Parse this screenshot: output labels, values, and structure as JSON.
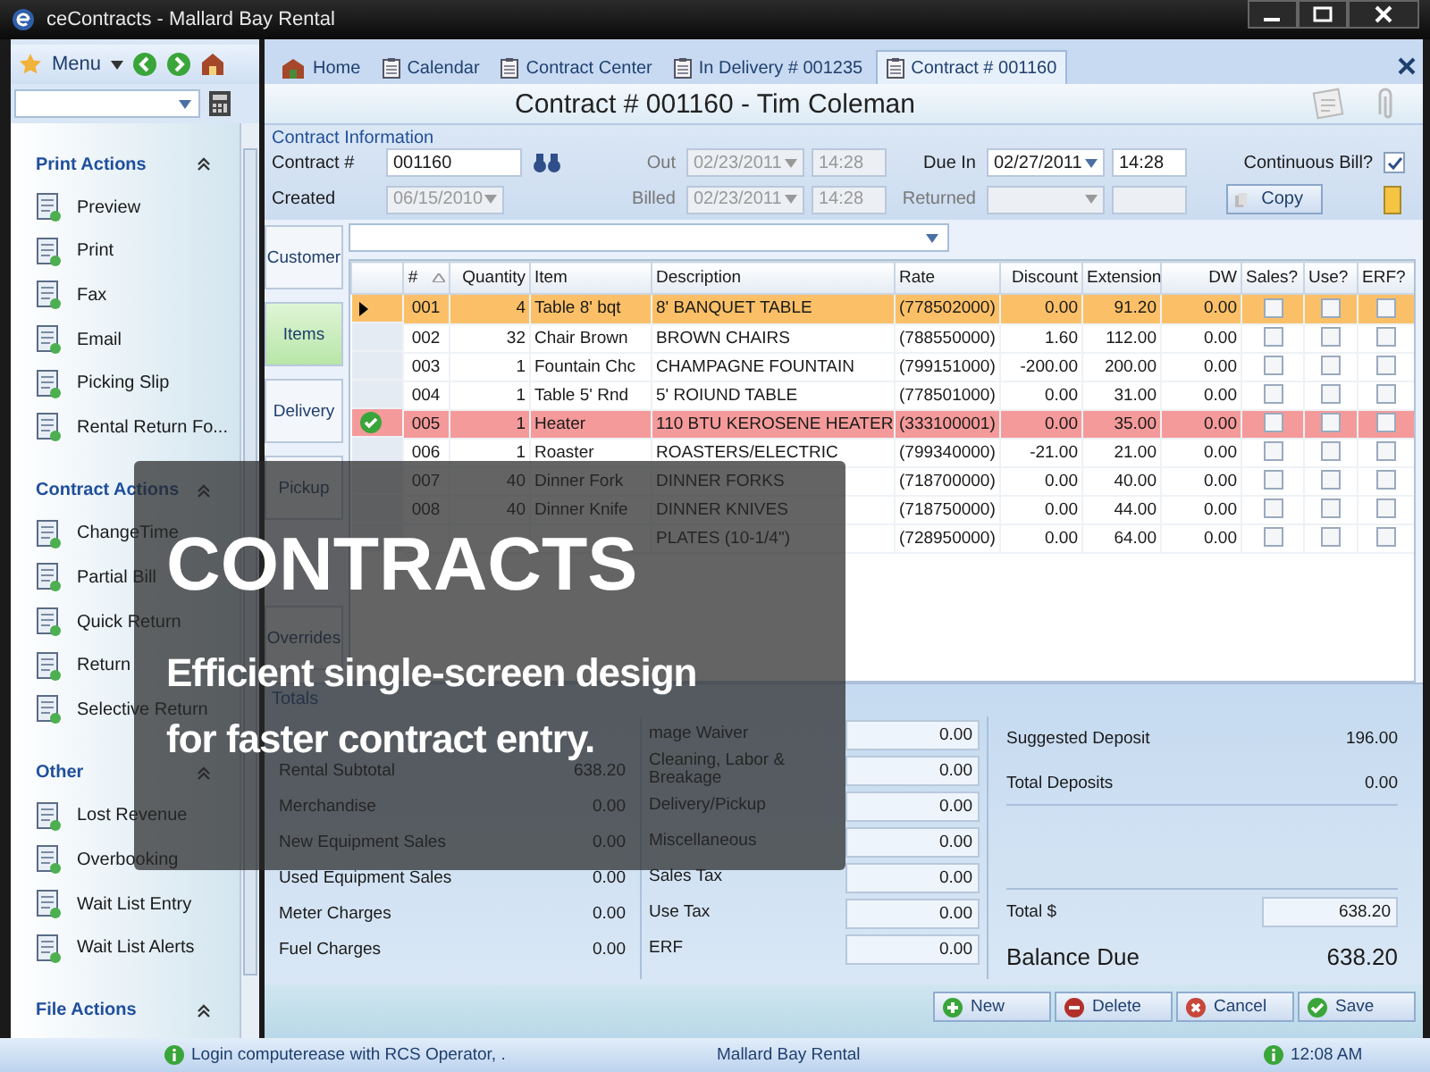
{
  "window": {
    "title": "ceContracts - Mallard Bay Rental"
  },
  "sidebar": {
    "menu_label": "Menu",
    "groups": [
      {
        "title": "Print Actions",
        "items": [
          "Preview",
          "Print",
          "Fax",
          "Email",
          "Picking Slip",
          "Rental Return Fo..."
        ]
      },
      {
        "title": "Contract Actions",
        "items": [
          "ChangeTime",
          "Partial Bill",
          "Quick Return",
          "Return",
          "Selective Return"
        ]
      },
      {
        "title": "Other",
        "items": [
          "Lost Revenue",
          "Overbooking",
          "Wait List Entry",
          "Wait List Alerts"
        ]
      },
      {
        "title": "File Actions"
      }
    ]
  },
  "tabs": [
    {
      "label": "Home",
      "selected": false
    },
    {
      "label": "Calendar",
      "selected": false
    },
    {
      "label": "Contract Center",
      "selected": false
    },
    {
      "label": "In Delivery # 001235",
      "selected": false
    },
    {
      "label": "Contract # 001160",
      "selected": true
    }
  ],
  "header": {
    "title": "Contract # 001160 - Tim Coleman"
  },
  "contract_info": {
    "title": "Contract Information",
    "contract_no": {
      "label": "Contract #",
      "value": "001160"
    },
    "created": {
      "label": "Created",
      "date": "06/15/2010",
      "disabled": true
    },
    "out": {
      "label": "Out",
      "date": "02/23/2011",
      "time": "14:28",
      "disabled": true
    },
    "billed": {
      "label": "Billed",
      "date": "02/23/2011",
      "time": "14:28",
      "disabled": true
    },
    "due_in": {
      "label": "Due In",
      "date": "02/27/2011",
      "time": "14:28",
      "disabled": false
    },
    "returned": {
      "label": "Returned",
      "disabled": true
    },
    "continuous_bill": {
      "label": "Continuous Bill?",
      "checked": true
    },
    "copy_button": "Copy"
  },
  "side_tabs": [
    {
      "label": "Customer",
      "selected": false
    },
    {
      "label": "Items",
      "selected": true
    },
    {
      "label": "Delivery",
      "selected": false
    },
    {
      "label": "Pickup",
      "selected": false
    },
    {
      "label": "Overrides",
      "selected": false
    }
  ],
  "table": {
    "columns": [
      "#",
      "Quantity",
      "Item",
      "Description",
      "Rate",
      "Discount",
      "Extension",
      "DW",
      "Sales?",
      "Use?",
      "ERF?"
    ],
    "rows": [
      {
        "num": "001",
        "quantity": "4",
        "item": "Table 8' bqt",
        "description": "8' BANQUET TABLE",
        "rate": "(778502000)",
        "discount": "0.00",
        "extension": "91.20",
        "dw": "0.00",
        "selected": true,
        "flagged": false,
        "sales": false,
        "use": false,
        "erf": false
      },
      {
        "num": "002",
        "quantity": "32",
        "item": "Chair Brown",
        "description": "BROWN CHAIRS",
        "rate": "(788550000)",
        "discount": "1.60",
        "extension": "112.00",
        "dw": "0.00",
        "selected": false,
        "flagged": false,
        "sales": false,
        "use": false,
        "erf": false
      },
      {
        "num": "003",
        "quantity": "1",
        "item": "Fountain Chc",
        "description": "CHAMPAGNE FOUNTAIN",
        "rate": "(799151000)",
        "discount": "-200.00",
        "extension": "200.00",
        "dw": "0.00",
        "selected": false,
        "flagged": false,
        "sales": false,
        "use": false,
        "erf": false
      },
      {
        "num": "004",
        "quantity": "1",
        "item": "Table 5' Rnd",
        "description": "5' ROIUND TABLE",
        "rate": "(778501000)",
        "discount": "0.00",
        "extension": "31.00",
        "dw": "0.00",
        "selected": false,
        "flagged": false,
        "sales": false,
        "use": false,
        "erf": false
      },
      {
        "num": "005",
        "quantity": "1",
        "item": "Heater",
        "description": "110 BTU KEROSENE HEATER",
        "rate": "(333100001)",
        "discount": "0.00",
        "extension": "35.00",
        "dw": "0.00",
        "selected": false,
        "flagged": true,
        "sales": false,
        "use": false,
        "erf": false
      },
      {
        "num": "006",
        "quantity": "1",
        "item": "Roaster",
        "description": "ROASTERS/ELECTRIC",
        "rate": "(799340000)",
        "discount": "-21.00",
        "extension": "21.00",
        "dw": "0.00",
        "selected": false,
        "flagged": false,
        "sales": false,
        "use": false,
        "erf": false
      },
      {
        "num": "007",
        "quantity": "40",
        "item": "Dinner Fork",
        "description": "DINNER FORKS",
        "rate": "(718700000)",
        "discount": "0.00",
        "extension": "40.00",
        "dw": "0.00",
        "selected": false,
        "flagged": false,
        "sales": false,
        "use": false,
        "erf": false
      },
      {
        "num": "008",
        "quantity": "40",
        "item": "Dinner Knife",
        "description": "DINNER KNIVES",
        "rate": "(718750000)",
        "discount": "0.00",
        "extension": "44.00",
        "dw": "0.00",
        "selected": false,
        "flagged": false,
        "sales": false,
        "use": false,
        "erf": false
      },
      {
        "description": "PLATES (10-1/4\")",
        "rate": "(728950000)",
        "discount": "0.00",
        "extension": "64.00",
        "dw": "0.00",
        "selected": false,
        "flagged": false,
        "sales": false,
        "use": false,
        "erf": false
      }
    ]
  },
  "totals": {
    "title": "Totals",
    "left": [
      {
        "label": "Rental Subtotal",
        "value": "638.20"
      },
      {
        "label": "Merchandise",
        "value": "0.00"
      },
      {
        "label": "New Equipment Sales",
        "value": "0.00"
      },
      {
        "label": "Used Equipment Sales",
        "value": "0.00"
      },
      {
        "label": "Meter Charges",
        "value": "0.00"
      },
      {
        "label": "Fuel Charges",
        "value": "0.00"
      }
    ],
    "middle": [
      {
        "label": "mage Waiver",
        "value": "0.00"
      },
      {
        "label": "Cleaning, Labor & Breakage",
        "value": "0.00"
      },
      {
        "label": "Delivery/Pickup",
        "value": "0.00"
      },
      {
        "label": "Miscellaneous",
        "value": "0.00"
      },
      {
        "label": "Sales Tax",
        "value": "0.00"
      },
      {
        "label": "Use Tax",
        "value": "0.00"
      },
      {
        "label": "ERF",
        "value": "0.00"
      }
    ],
    "suggested_deposit": {
      "label": "Suggested Deposit",
      "value": "196.00"
    },
    "total_deposits": {
      "label": "Total Deposits",
      "value": "0.00"
    },
    "total": {
      "label": "Total $",
      "value": "638.20"
    },
    "balance_due": {
      "label": "Balance Due",
      "value": "638.20"
    }
  },
  "buttons": [
    {
      "label": "New",
      "kind": "new"
    },
    {
      "label": "Delete",
      "kind": "delete"
    },
    {
      "label": "Cancel",
      "kind": "cancel"
    },
    {
      "label": "Save",
      "kind": "save"
    }
  ],
  "status_bar": {
    "login": "Login computerease with RCS Operator, .",
    "company": "Mallard Bay Rental",
    "time": "12:08 AM"
  },
  "promo": {
    "title": "CONTRACTS",
    "lines": [
      "Efficient single-screen design",
      "for faster contract entry."
    ]
  }
}
